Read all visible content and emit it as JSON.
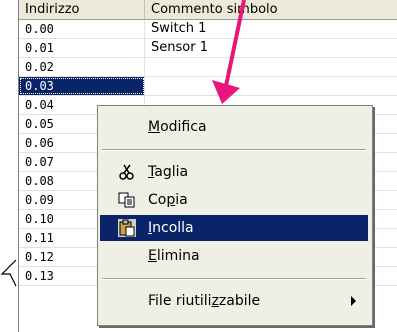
{
  "table": {
    "headers": {
      "address": "Indirizzo",
      "comment": "Commento simbolo"
    },
    "rows": [
      {
        "address": "0.00",
        "comment": "Switch 1"
      },
      {
        "address": "0.01",
        "comment": "Sensor 1"
      },
      {
        "address": "0.02",
        "comment": ""
      },
      {
        "address": "0.03",
        "comment": ""
      },
      {
        "address": "0.04",
        "comment": ""
      },
      {
        "address": "0.05",
        "comment": ""
      },
      {
        "address": "0.06",
        "comment": ""
      },
      {
        "address": "0.07",
        "comment": ""
      },
      {
        "address": "0.08",
        "comment": ""
      },
      {
        "address": "0.09",
        "comment": ""
      },
      {
        "address": "0.10",
        "comment": ""
      },
      {
        "address": "0.11",
        "comment": ""
      },
      {
        "address": "0.12",
        "comment": ""
      },
      {
        "address": "0.13",
        "comment": ""
      }
    ],
    "selected_address": "0.03"
  },
  "context_menu": {
    "modify": {
      "first": "M",
      "rest": "odifica"
    },
    "cut": {
      "first": "T",
      "rest": "aglia"
    },
    "copy": {
      "pre": "Co",
      "u": "p",
      "post": "ia"
    },
    "paste": {
      "first": "I",
      "rest": "ncolla"
    },
    "delete": {
      "first": "E",
      "rest": "limina"
    },
    "reusable_file": {
      "pre": "File riutili",
      "u": "z",
      "post": "zabile"
    }
  },
  "colors": {
    "selection": "#0a246a",
    "annotation_arrow": "#e8157a"
  }
}
